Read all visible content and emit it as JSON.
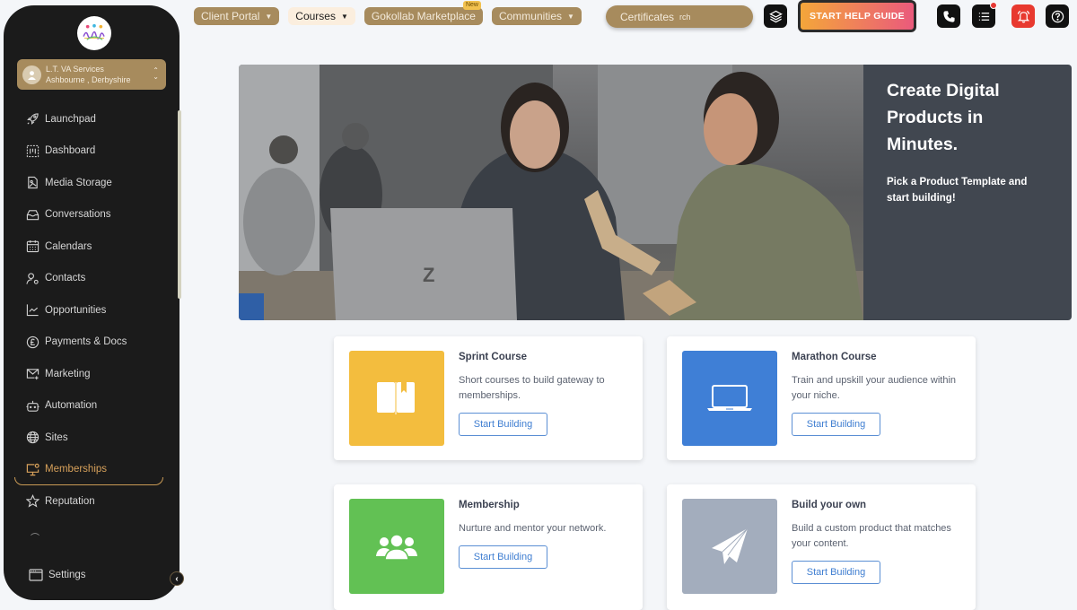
{
  "sidebar": {
    "account": {
      "name": "L.T. VA Services",
      "location": "Ashbourne , Derbyshire"
    },
    "items": [
      {
        "label": "Launchpad",
        "icon": "rocket-icon"
      },
      {
        "label": "Dashboard",
        "icon": "dashboard-icon"
      },
      {
        "label": "Media Storage",
        "icon": "media-icon"
      },
      {
        "label": "Conversations",
        "icon": "inbox-icon"
      },
      {
        "label": "Calendars",
        "icon": "calendar-icon"
      },
      {
        "label": "Contacts",
        "icon": "contacts-icon"
      },
      {
        "label": "Opportunities",
        "icon": "chart-icon"
      },
      {
        "label": "Payments & Docs",
        "icon": "pound-icon"
      },
      {
        "label": "Marketing",
        "icon": "mail-icon"
      },
      {
        "label": "Automation",
        "icon": "robot-icon"
      },
      {
        "label": "Sites",
        "icon": "globe-icon"
      },
      {
        "label": "Memberships",
        "icon": "monitor-icon",
        "active": true
      },
      {
        "label": "Reputation",
        "icon": "star-icon"
      }
    ],
    "settings_label": "Settings"
  },
  "topnav": {
    "items": [
      {
        "label": "Client Portal",
        "dropdown": true
      },
      {
        "label": "Courses",
        "dropdown": true,
        "active": true
      },
      {
        "label": "Gokollab Marketplace",
        "badge": "New"
      },
      {
        "label": "Communities",
        "dropdown": true
      }
    ],
    "certificates_label": "Certificates",
    "search_fragment": "rch",
    "help_button": "START HELP GUIDE"
  },
  "hero": {
    "title": "Create Digital Products in Minutes.",
    "subtitle": "Pick a Product Template and start building!"
  },
  "cards": [
    {
      "title": "Sprint Course",
      "desc": "Short courses to build gateway to memberships.",
      "button": "Start Building",
      "color": "#f3bd3e",
      "icon": "book-icon"
    },
    {
      "title": "Marathon Course",
      "desc": "Train and upskill your audience within your niche.",
      "button": "Start Building",
      "color": "#3f7fd6",
      "icon": "laptop-icon"
    },
    {
      "title": "Membership",
      "desc": "Nurture and mentor your network.",
      "button": "Start Building",
      "color": "#62c154",
      "icon": "group-icon"
    },
    {
      "title": "Build your own",
      "desc": "Build a custom product that matches your content.",
      "button": "Start Building",
      "color": "#a3adbd",
      "icon": "paper-plane-icon"
    }
  ]
}
